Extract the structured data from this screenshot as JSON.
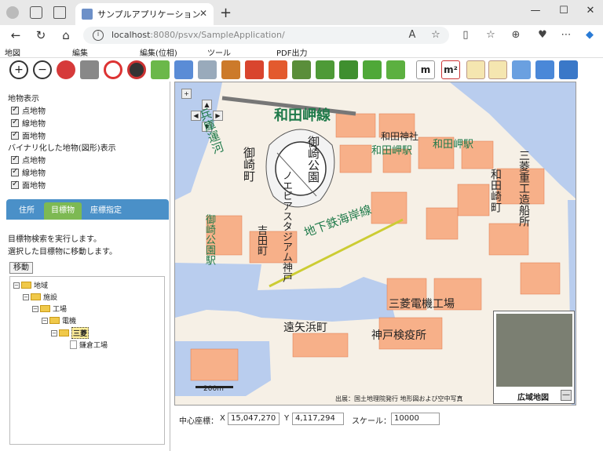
{
  "browser": {
    "tab_title": "サンプルアプリケーション",
    "tab_close": "✕",
    "new_tab": "+",
    "url_host": "localhost",
    "url_rest": ":8080/psvx/SampleApplication/",
    "win_min": "—",
    "win_max": "☐",
    "win_close": "✕"
  },
  "menu": {
    "items": [
      "地図",
      "編集",
      "編集(位相)",
      "ツール",
      "PDF出力"
    ]
  },
  "left": {
    "display_title": "地物表示",
    "display_items": [
      "点地物",
      "線地物",
      "面地物"
    ],
    "binary_title": "バイナリ化した地物(図形)表示",
    "binary_items": [
      "点地物",
      "線地物",
      "面地物"
    ],
    "tabs": [
      "住所",
      "目標物",
      "座標指定"
    ],
    "desc1": "目標物検索を実行します。",
    "desc2": "選択した目標物に移動します。",
    "move_button": "移動",
    "tree": [
      {
        "label": "地域"
      },
      {
        "label": "施設"
      },
      {
        "label": "工場"
      },
      {
        "label": "電機"
      },
      {
        "label": "三菱"
      },
      {
        "label": "鎌倉工場"
      }
    ]
  },
  "map": {
    "labels": [
      "和田岬線",
      "和田神社",
      "和田岬駅",
      "和田岬駅",
      "御崎公園",
      "御崎町",
      "ノエビアスタジアム神戸",
      "兵庫運河",
      "地下鉄海岸線",
      "御崎公園駅",
      "吉田町",
      "和田崎町",
      "三菱重工造船所",
      "三菱電機工場",
      "遠矢浜町",
      "神戸検疫所"
    ],
    "credit": "出展：国土地理院発行 地形図および空中写真",
    "scale_label": "200m",
    "wide_map_label": "広域地図",
    "wide_map_min": "—"
  },
  "status": {
    "center_label": "中心座標：",
    "x_label": "X",
    "x_value": "15,047,270",
    "y_label": "Y",
    "y_value": "4,117,294",
    "scale_label": "スケール：",
    "scale_value": "10000"
  }
}
